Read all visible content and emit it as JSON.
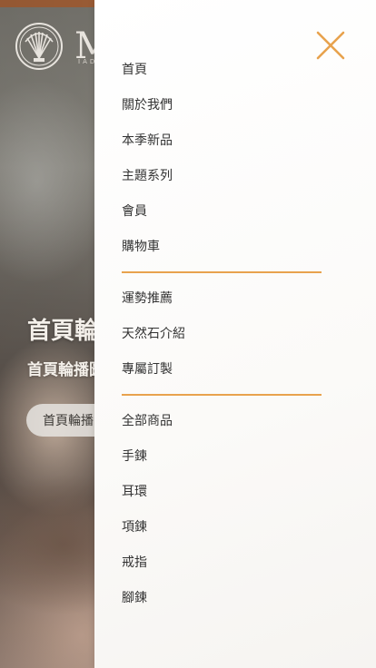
{
  "hero": {
    "logo_text": "M",
    "logo_sub": "IAD",
    "title": "首頁輪播",
    "subtitle": "首頁輪播圖",
    "button_label": "首頁輪播"
  },
  "drawer": {
    "close_icon": "close-icon",
    "accent_color": "#e8a24d",
    "groups": [
      [
        "首頁",
        "關於我們",
        "本季新品",
        "主題系列",
        "會員",
        "購物車"
      ],
      [
        "運勢推薦",
        "天然石介紹",
        "專屬訂製"
      ],
      [
        "全部商品",
        "手鍊",
        "耳環",
        "項鍊",
        "戒指",
        "腳鍊"
      ]
    ]
  }
}
